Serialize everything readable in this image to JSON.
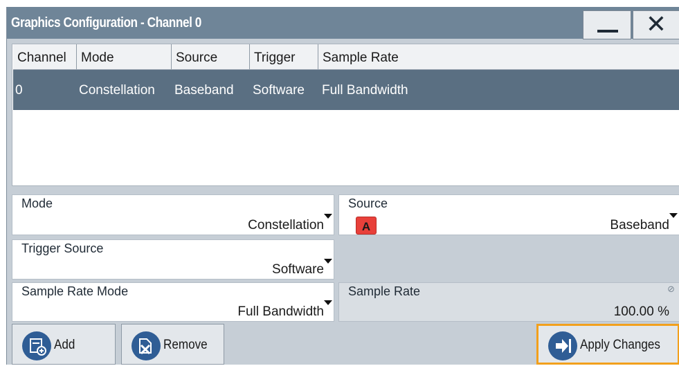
{
  "window": {
    "title": "Graphics Configuration - Channel 0",
    "minimize_icon": "minimize-icon",
    "close_icon": "close-icon",
    "close_glyph": "✕"
  },
  "table": {
    "columns": [
      "Channel",
      "Mode",
      "Source",
      "Trigger",
      "Sample Rate"
    ],
    "rows": [
      {
        "channel": "0",
        "mode": "Constellation",
        "source": "Baseband",
        "trigger": "Software",
        "sample_rate": "Full Bandwidth"
      }
    ]
  },
  "fields": {
    "mode": {
      "label": "Mode",
      "value": "Constellation"
    },
    "source": {
      "label": "Source",
      "value": "Baseband",
      "badge": "A"
    },
    "trigger_source": {
      "label": "Trigger Source",
      "value": "Software"
    },
    "sample_rate_mode": {
      "label": "Sample Rate Mode",
      "value": "Full Bandwidth"
    },
    "sample_rate": {
      "label": "Sample Rate",
      "value": "100.00 %"
    }
  },
  "buttons": {
    "add": "Add",
    "remove": "Remove",
    "apply": "Apply Changes"
  },
  "colors": {
    "titlebar": "#6f8598",
    "selected_row": "#5a6f82",
    "button_icon": "#2f5d95",
    "badge": "#e8403a",
    "apply_border": "#f2a01c"
  }
}
